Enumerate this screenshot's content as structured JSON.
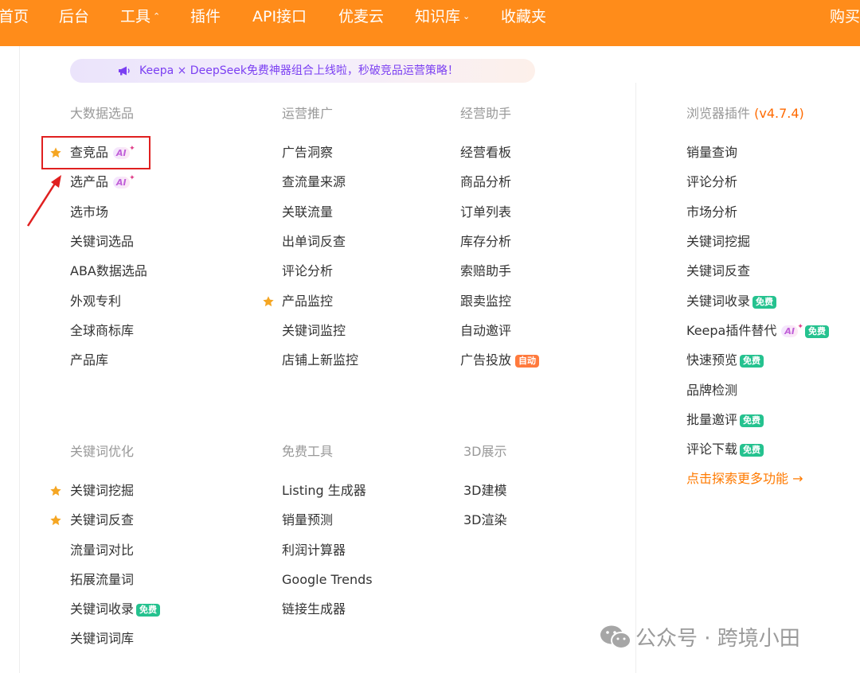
{
  "nav": {
    "items": [
      {
        "label": "首页"
      },
      {
        "label": "后台"
      },
      {
        "label": "工具",
        "has_caret": true
      },
      {
        "label": "插件"
      },
      {
        "label": "API接口"
      },
      {
        "label": "优麦云"
      },
      {
        "label": "知识库",
        "has_caret": true
      },
      {
        "label": "收藏夹"
      },
      {
        "label": "购买"
      }
    ],
    "caret": "⌃",
    "caret_down": "⌄"
  },
  "banner": {
    "text": "Keepa × DeepSeek免费神器组合上线啦，秒破竞品运营策略！",
    "icon": "megaphone-icon"
  },
  "sections": {
    "big_data": {
      "title": "大数据选品",
      "items": [
        "查竞品",
        "选产品",
        "选市场",
        "关键词选品",
        "ABA数据选品",
        "外观专利",
        "全球商标库",
        "产品库"
      ]
    },
    "operations": {
      "title": "运营推广",
      "items": [
        "广告洞察",
        "查流量来源",
        "关联流量",
        "出单词反查",
        "评论分析",
        "产品监控",
        "关键词监控",
        "店铺上新监控"
      ]
    },
    "business": {
      "title": "经营助手",
      "items": [
        "经营看板",
        "商品分析",
        "订单列表",
        "库存分析",
        "索赔助手",
        "跟卖监控",
        "自动邀评",
        "广告投放"
      ]
    },
    "plugin": {
      "title": "浏览器插件",
      "version": "(v4.7.4)",
      "items": [
        "销量查询",
        "评论分析",
        "市场分析",
        "关键词挖掘",
        "关键词反查",
        "关键词收录",
        "Keepa插件替代",
        "快速预览",
        "品牌检测",
        "批量邀评",
        "评论下载"
      ],
      "explore_link": "点击探索更多功能 →"
    },
    "keyword": {
      "title": "关键词优化",
      "items": [
        "关键词挖掘",
        "关键词反查",
        "流量词对比",
        "拓展流量词",
        "关键词收录",
        "关键词词库"
      ]
    },
    "free_tools": {
      "title": "免费工具",
      "items": [
        "Listing 生成器",
        "销量预测",
        "利润计算器",
        "Google Trends",
        "链接生成器"
      ]
    },
    "show3d": {
      "title": "3D展示",
      "items": [
        "3D建模",
        "3D渲染"
      ]
    }
  },
  "badges": {
    "ai": "AI",
    "ai_spark": "✦",
    "free": "免费",
    "auto": "自动"
  },
  "colors": {
    "nav_bg": "#ff8c1a",
    "accent_orange": "#ff7a00",
    "free_green": "#25c28f",
    "highlight_red": "#e02020",
    "star": "#f5a623",
    "banner_text": "#7b3ff2"
  },
  "watermark": {
    "text": "公众号 · 跨境小田"
  }
}
